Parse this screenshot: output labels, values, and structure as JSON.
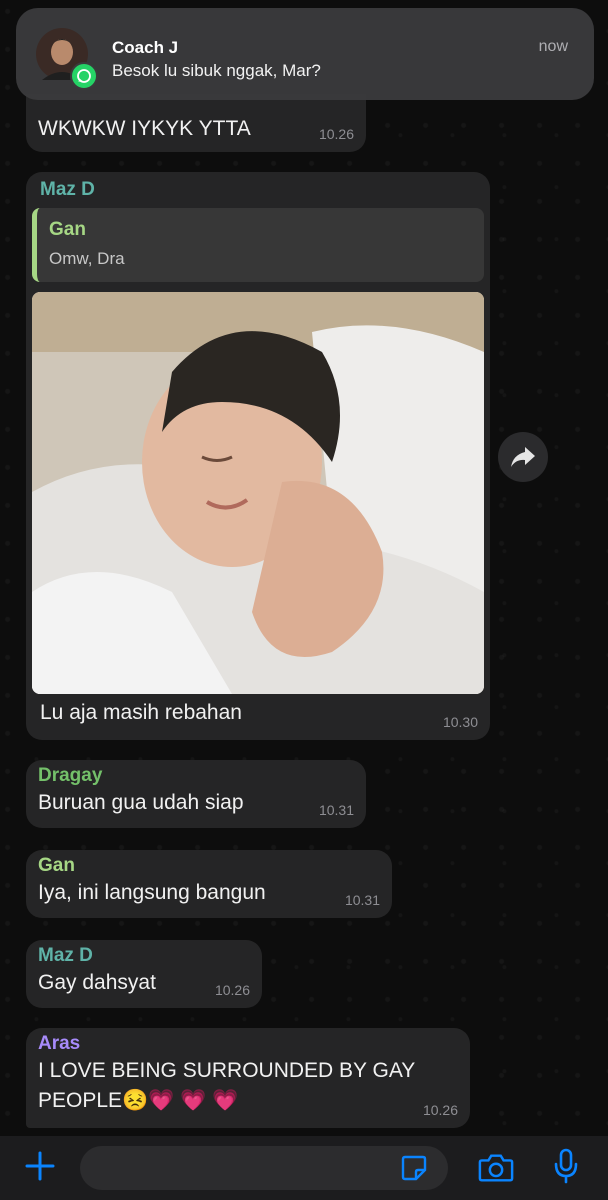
{
  "notification": {
    "title": "Coach J",
    "body": "Besok lu sibuk nggak, Mar?",
    "time": "now"
  },
  "messages": [
    {
      "text": "WKWKW IYKYK YTTA",
      "time": "10.26"
    },
    {
      "sender": "Maz D",
      "sender_color": "#5fb3a8",
      "quote": {
        "sender": "Gan",
        "text": "Omw, Dra"
      },
      "text": "Lu aja masih rebahan",
      "time": "10.30"
    },
    {
      "sender": "Dragay",
      "sender_color": "#74c06a",
      "text": "Buruan gua udah siap",
      "time": "10.31"
    },
    {
      "sender": "Gan",
      "sender_color": "#a6d785",
      "text": "Iya, ini langsung bangun",
      "time": "10.31"
    },
    {
      "sender": "Maz D",
      "sender_color": "#5fb3a8",
      "text": "Gay dahsyat",
      "time": "10.26"
    },
    {
      "sender": "Aras",
      "sender_color": "#a78bfa",
      "text_line1": "I LOVE BEING SURROUNDED BY GAY",
      "text_line2": "PEOPLE😣💗 💗 💗",
      "time": "10.26"
    }
  ],
  "icons": {
    "forward": "forward-arrow-icon",
    "plus": "plus-icon",
    "sticker": "sticker-icon",
    "camera": "camera-icon",
    "mic": "microphone-icon",
    "app": "whatsapp-icon"
  },
  "colors": {
    "accent": "#0a84ff",
    "bubble": "#252526"
  }
}
